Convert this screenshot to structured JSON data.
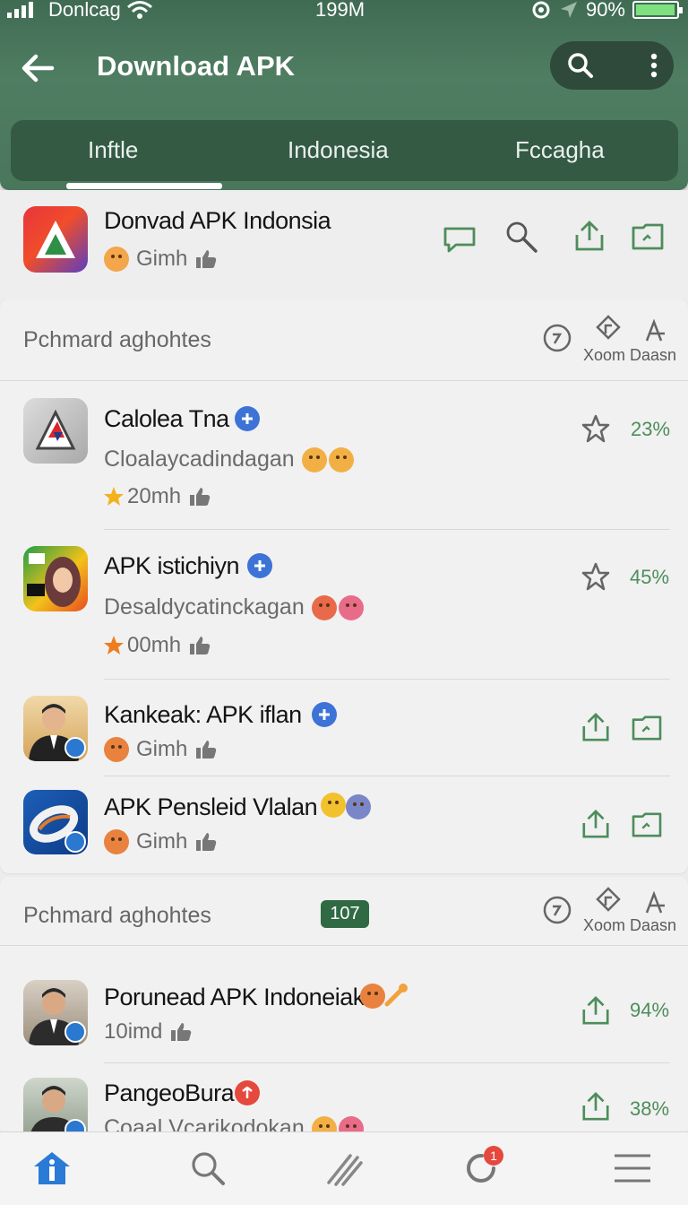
{
  "status_bar": {
    "carrier": "Donlcag",
    "time": "199M",
    "battery": "90%",
    "battery_level": 0.9
  },
  "header": {
    "title": "Download APK"
  },
  "tabs": [
    {
      "label": "Inftle"
    },
    {
      "label": "Indonesia"
    },
    {
      "label": "Fccagha"
    }
  ],
  "featured": {
    "name": "Donvad APK Indonsia",
    "meta": "Gimh"
  },
  "sections": [
    {
      "title": "Pchmard aghohtes",
      "action_label": "Xoom Daasn",
      "apps": [
        {
          "name": "Calolea Tna",
          "developer": "Cloalaycadindagan",
          "meta": "20mh",
          "percent": "23%"
        },
        {
          "name": "APK istichiyn",
          "developer": "Desaldycatinckagan",
          "meta": "00mh",
          "percent": "45%"
        },
        {
          "name": "Kankeak: APK iflan",
          "meta": "Gimh"
        },
        {
          "name": "APK Pensleid Vlalan",
          "meta": "Gimh"
        }
      ]
    },
    {
      "title": "Pchmard aghohtes",
      "badge": "107",
      "action_label": "Xoom Daasn",
      "apps": [
        {
          "name": "Porunead APK Indoneiak",
          "meta": "10imd",
          "percent": "94%"
        },
        {
          "name": "PangeoBura",
          "developer": "Coaal Vcarikodokan",
          "percent": "38%"
        }
      ]
    }
  ],
  "bottom_nav": {
    "notification_count": "1"
  },
  "colors": {
    "header_green": "#4a775c",
    "accent_green": "#4d8d5b",
    "verified_blue": "#3d73d6",
    "badge_green": "#2f6a44"
  }
}
